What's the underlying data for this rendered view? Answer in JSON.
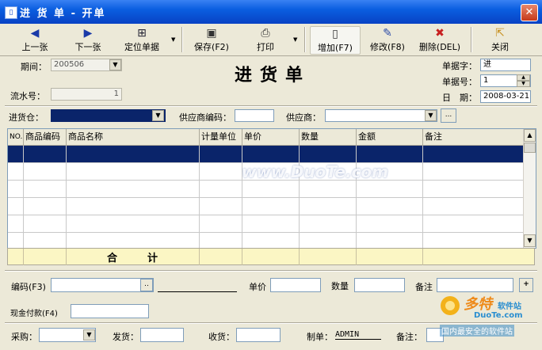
{
  "window": {
    "title": "进 货 单 - 开单",
    "close": "✕"
  },
  "toolbar": {
    "prev": "上一张",
    "next": "下一张",
    "locate": "定位单据",
    "save": "保存(F2)",
    "print": "打印",
    "add": "增加(F7)",
    "edit": "修改(F8)",
    "delete": "删除(DEL)",
    "close": "关闭"
  },
  "header": {
    "doc_title": "进货单",
    "period_label": "期间：",
    "period_value": "200506",
    "serial_label": "流水号：",
    "serial_value": "1",
    "doc_code_label": "单据字：",
    "doc_code_value": "进",
    "doc_no_label": "单据号：",
    "doc_no_value": "1",
    "date_label": "日　期：",
    "date_value": "2008-03-21",
    "warehouse_label": "进货仓：",
    "supplier_code_label": "供应商编码：",
    "supplier_label": "供应商：",
    "ellipsis": "..."
  },
  "grid": {
    "columns": [
      "NO.",
      "商品编码",
      "商品名称",
      "计量单位",
      "单价",
      "数量",
      "金额",
      "备注"
    ],
    "watermark": "www.DuoTe.com",
    "total_label": "合计"
  },
  "entry": {
    "code_label": "编码(F3)",
    "code_btn": "..",
    "price_label": "单价",
    "qty_label": "数量",
    "remark_label": "备注",
    "add_btn": "+",
    "cash_label": "现金付款(F4)"
  },
  "footer": {
    "purchase_label": "采购：",
    "ship_label": "发货：",
    "receive_label": "收货：",
    "maker_label": "制单：",
    "maker_value": "ADMIN",
    "remark_label": "备注："
  },
  "logo": {
    "brand": "多特",
    "brand_suffix": "软件站",
    "domain": "DuoTe.com",
    "slogan": "国内最安全的软件站"
  }
}
